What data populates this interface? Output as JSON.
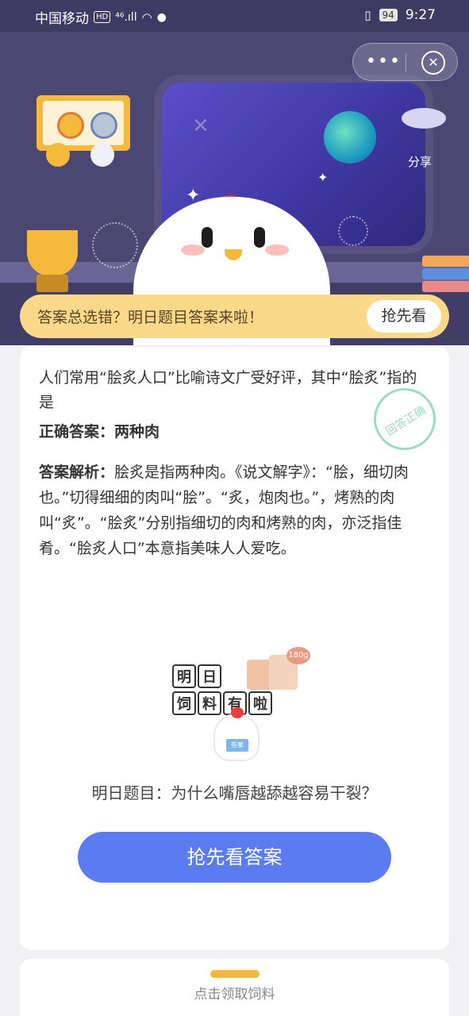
{
  "status_bar": {
    "carrier": "中国移动",
    "hd": "HD",
    "network": "⁴⁶.ıll",
    "battery": "94",
    "time": "9:27"
  },
  "header": {
    "more_icon": "more-dots-icon",
    "close_icon": "close-circle-icon",
    "share_label": "分享"
  },
  "banner": {
    "text": "答案总选错？明日题目答案来啦！",
    "button": "抢先看"
  },
  "card": {
    "question": "人们常用“脍炙人口”比喻诗文广受好评，其中“脍炙”指的是",
    "stamp": "回答正确",
    "correct_label": "正确答案：",
    "correct_value": "两种肉",
    "analysis_label": "答案解析：",
    "analysis_text": "脍炙是指两种肉。《说文解字》：“脍，细切肉也。”切得细细的肉叫“脍”。“炙，炮肉也。”，烤熟的肉叫“炙”。“脍炙”分别指细切的肉和烤熟的肉，亦泛指佳肴。“脍炙人口”本意指美味人人爱吃。",
    "illustration": {
      "tiles": [
        "明",
        "日",
        "饲",
        "料",
        "有",
        "啦"
      ],
      "bag_tag": "180g",
      "book_text": "答案"
    },
    "tomorrow_question": "明日题目：为什么嘴唇越舔越容易干裂？",
    "cta_button": "抢先看答案"
  },
  "bottom": {
    "label": "点击领取饲料"
  },
  "colors": {
    "scene_bg": "#4b4772",
    "banner_bg": "#fbd98a",
    "cta_bg": "#5b7bf0",
    "accent_yellow": "#f3b93f"
  }
}
